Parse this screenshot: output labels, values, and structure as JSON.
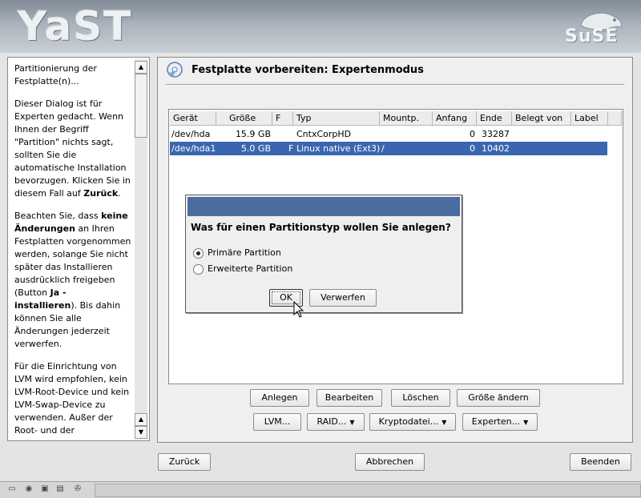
{
  "header": {
    "app_logo": "YaST",
    "vendor_logo": "SuSE"
  },
  "help": {
    "paragraphs": [
      "Partitionierung der Festplatte(n)...",
      "Dieser Dialog ist für Experten gedacht. Wenn Ihnen der Begriff \"Partition\" nichts sagt, sollten Sie die automatische Installation bevorzugen. Klicken Sie in diesem Fall auf ",
      "Beachten Sie, dass ",
      "Für die Einrichtung von LVM wird empfohlen, kein LVM-Root-Device und kein LVM-Swap-Device zu verwenden. Außer der Root- und der"
    ],
    "p2_bold": "Zurück",
    "p2_end": ".",
    "p3_bold1": "keine Änderungen",
    "p3_mid": " an Ihren Festplatten vorgenommen werden, solange Sie nicht später das Installieren ausdrücklich freigeben (Button ",
    "p3_bold2": "Ja - installieren",
    "p3_end": "). Bis dahin können Sie alle Änderungen jederzeit verwerfen."
  },
  "main": {
    "title": "Festplatte vorbereiten: Expertenmodus",
    "table": {
      "columns": [
        "Gerät",
        "Größe",
        "F",
        "Typ",
        "Mountp.",
        "Anfang",
        "Ende",
        "Belegt von",
        "Label"
      ],
      "rows": [
        {
          "device": "/dev/hda",
          "size": "15.9 GB",
          "f": "",
          "type": "CntxCorpHD",
          "mount": "",
          "start": "0",
          "end": "33287",
          "used_by": "",
          "label": ""
        },
        {
          "device": "/dev/hda1",
          "size": "5.0 GB",
          "f": "F",
          "type": "Linux native (Ext3)",
          "mount": "/",
          "start": "0",
          "end": "10402",
          "used_by": "",
          "label": ""
        }
      ]
    },
    "buttons_row1": [
      {
        "label": "Anlegen"
      },
      {
        "label": "Bearbeiten"
      },
      {
        "label": "Löschen"
      },
      {
        "label": "Größe ändern"
      }
    ],
    "buttons_row2": [
      {
        "label": "LVM..."
      },
      {
        "label": "RAID..."
      },
      {
        "label": "Kryptodatei..."
      },
      {
        "label": "Experten..."
      }
    ]
  },
  "dialog": {
    "question": "Was für einen Partitionstyp wollen Sie anlegen?",
    "options": [
      {
        "label": "Primäre Partition",
        "selected": true
      },
      {
        "label": "Erweiterte Partition",
        "selected": false
      }
    ],
    "ok_label": "OK",
    "cancel_label": "Verwerfen"
  },
  "footer": {
    "back_label": "Zurück",
    "abort_label": "Abbrechen",
    "finish_label": "Beenden"
  },
  "colors": {
    "selection": "#3a66b0",
    "dialog_title": "#4a6c9f"
  }
}
